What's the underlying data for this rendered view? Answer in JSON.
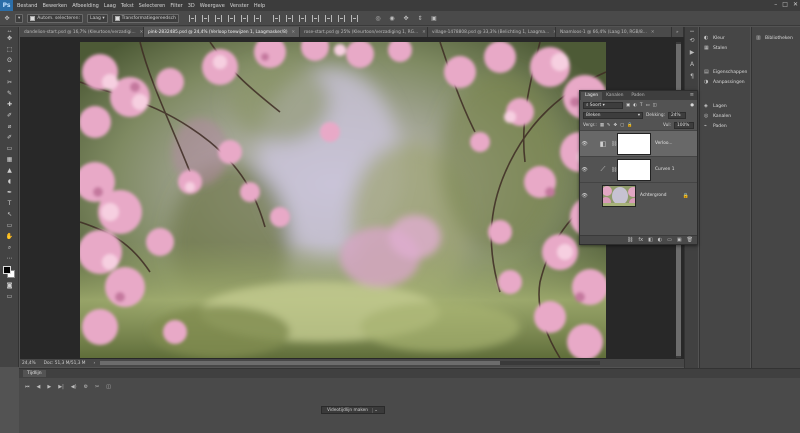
{
  "app": {
    "logo": "Ps",
    "menu": [
      "Bestand",
      "Bewerken",
      "Afbeelding",
      "Laag",
      "Tekst",
      "Selecteren",
      "Filter",
      "3D",
      "Weergave",
      "Venster",
      "Help"
    ],
    "window_controls": [
      "–",
      "□",
      "✕"
    ]
  },
  "options": {
    "auto_select_label": "Autom. selecteren:",
    "auto_select_target": "Laag",
    "transform_label": "Transformatiegereedsch"
  },
  "tabs": [
    {
      "label": "dandelion-start.psd @ 16,7% (Kleurtoon/verzadigi...",
      "active": false
    },
    {
      "label": "pink-2832485.psd @ 24,4% (Verloop toewijzen 1, Laagmasker/8)",
      "active": true
    },
    {
      "label": "rose-start.psd @ 25% (Kleurtoon/verzadiging 1, RG...",
      "active": false
    },
    {
      "label": "village-1478808.psd @ 33,3% (Belichting 1, Laagma...",
      "active": false
    },
    {
      "label": "Naamloos-1 @ 66,4% (Laag 10, RGB/8...",
      "active": false
    }
  ],
  "status": {
    "zoom": "24,4%",
    "doc": "Doc: 51,3 M/51,3 M",
    "arrow": "›"
  },
  "timeline": {
    "tab_label": "Tijdlijn",
    "controls": [
      "⏮",
      "◀",
      "▶",
      "▶|",
      "◀)",
      "⚙",
      "✂",
      "◫"
    ],
    "create_button": "Videotijdlijn maken",
    "dropdown": "⌄"
  },
  "strip_b": {
    "group1": [
      {
        "icon": "◐",
        "label": "Kleur"
      },
      {
        "icon": "▦",
        "label": "Stalen"
      }
    ],
    "group2": [
      {
        "icon": "▤",
        "label": "Eigenschappen"
      },
      {
        "icon": "◑",
        "label": "Aanpassingen"
      }
    ],
    "group3": [
      {
        "icon": "◈",
        "label": "Lagen"
      },
      {
        "icon": "◎",
        "label": "Kanalen"
      },
      {
        "icon": "⌁",
        "label": "Paden"
      }
    ]
  },
  "strip_c": {
    "items": [
      {
        "icon": "▥",
        "label": "Bibliotheken"
      }
    ]
  },
  "layers_panel": {
    "tabs": [
      "Lagen",
      "Kanalen",
      "Paden"
    ],
    "menu_icon": "≡",
    "filter_kind": "Soort",
    "blend_mode": "Bleken",
    "opacity_label": "Dekking:",
    "opacity_value": "24%",
    "lock_label": "Vergr.:",
    "fill_label": "Vul:",
    "fill_value": "100%",
    "layers": [
      {
        "name": "Verloo...",
        "adj_icon": "◧",
        "selected": true,
        "type": "adjustment"
      },
      {
        "name": "Curven 1",
        "adj_icon": "⟋",
        "selected": false,
        "type": "adjustment"
      },
      {
        "name": "Achtergrond",
        "selected": false,
        "type": "background"
      }
    ],
    "footer_icons": [
      "⛓",
      "fx",
      "◧",
      "◐",
      "▭",
      "▣",
      "🗑"
    ]
  },
  "toolbar_glyphs": [
    "✥",
    "⬚",
    "ʘ",
    "⌖",
    "✎",
    "✐",
    "✚",
    "⌀",
    "✂",
    "▦",
    "◢",
    "▲",
    "◖",
    "✒",
    "T",
    "↖",
    "▭",
    "✋",
    "⌕",
    "⋯"
  ]
}
